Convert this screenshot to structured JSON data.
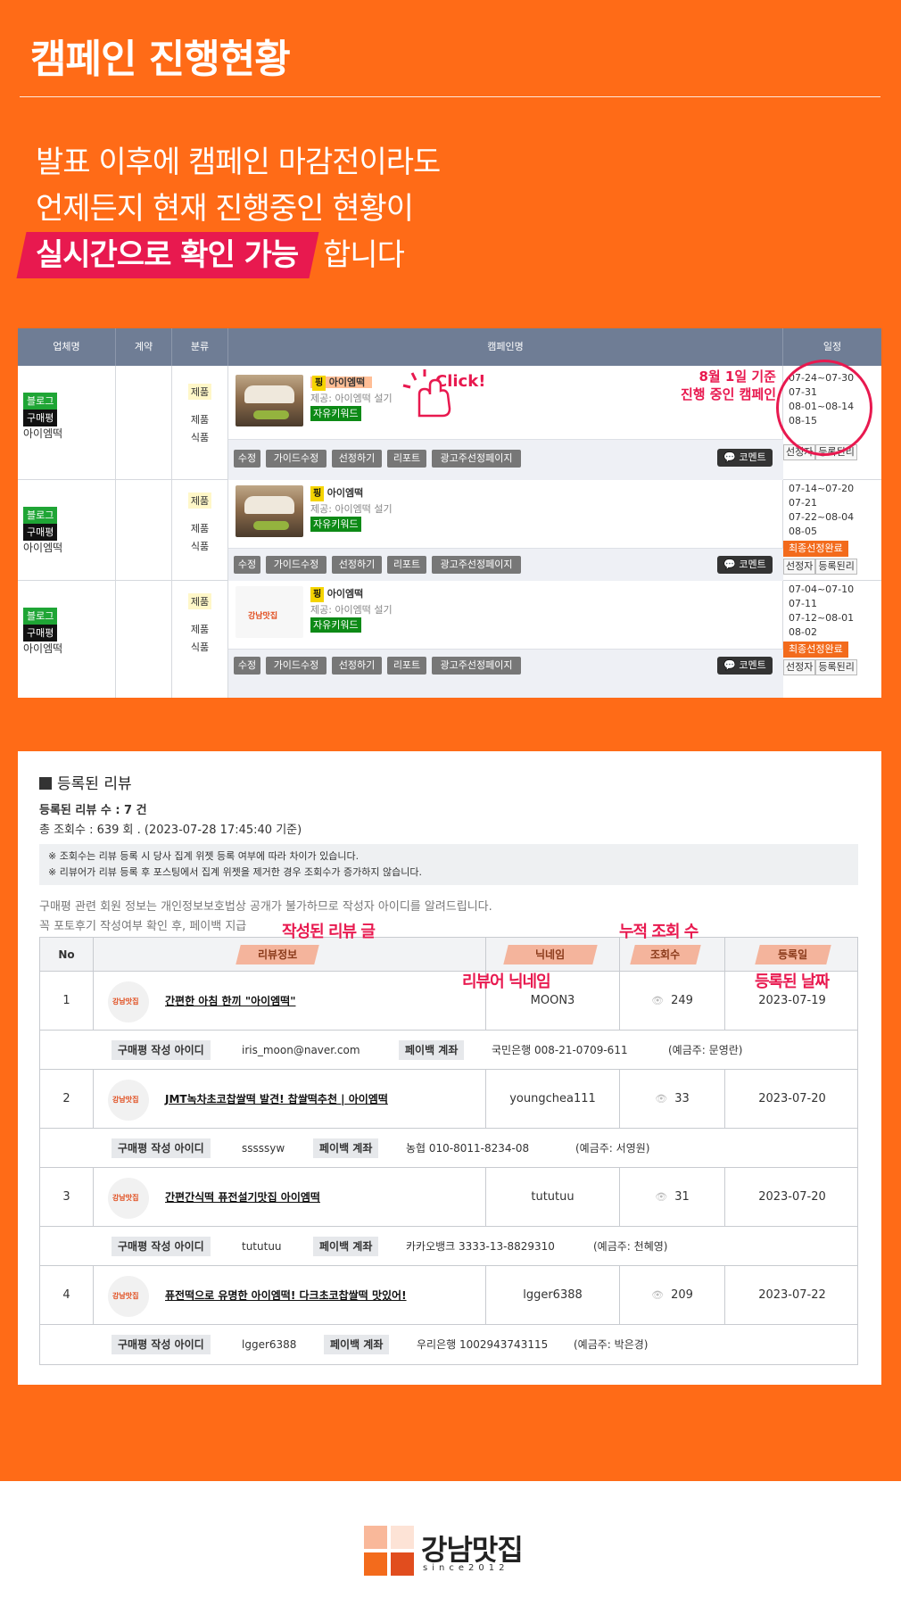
{
  "header": {
    "title": "캠페인 진행현황",
    "intro_line1": "발표 이후에 캠페인 마감전이라도",
    "intro_line2": "언제든지 현재 진행중인 현황이",
    "intro_highlight": "실시간으로 확인 가능",
    "intro_suffix": " 합니다"
  },
  "campaign_table": {
    "columns": [
      "업체명",
      "계약",
      "분류",
      "캠페인명",
      "일정"
    ],
    "rows": [
      {
        "badge_blog": "블로그",
        "badge_buy": "구매평",
        "company": "아이엠떡",
        "class_tag": "제품",
        "class_sub1": "제품",
        "class_sub2": "식품",
        "ping": "핑",
        "name": "아이엠떡",
        "provider": "제공: 아이엠떡 설기",
        "keyword": "자유키워드",
        "buttons": [
          "수정",
          "가이드수정",
          "선정하기",
          "리포트",
          "광고주선정페이지"
        ],
        "comment": "코멘트",
        "dates": [
          "07-24~07-30",
          "07-31",
          "08-01~08-14",
          "08-15"
        ],
        "final": "",
        "date_buttons": [
          "선정자",
          "등록된리"
        ]
      },
      {
        "badge_blog": "블로그",
        "badge_buy": "구매평",
        "company": "아이엠떡",
        "class_tag": "제품",
        "class_sub1": "제품",
        "class_sub2": "식품",
        "ping": "핑",
        "name": "아이엠떡",
        "provider": "제공: 아이엠떡 설기",
        "keyword": "자유키워드",
        "buttons": [
          "수정",
          "가이드수정",
          "선정하기",
          "리포트",
          "광고주선정페이지"
        ],
        "comment": "코멘트",
        "dates": [
          "07-14~07-20",
          "07-21",
          "07-22~08-04",
          "08-05"
        ],
        "final": "최종선정완료",
        "date_buttons": [
          "선정자",
          "등록된리"
        ]
      },
      {
        "badge_blog": "블로그",
        "badge_buy": "구매평",
        "company": "아이엠떡",
        "class_tag": "제품",
        "class_sub1": "제품",
        "class_sub2": "식품",
        "ping": "핑",
        "name": "아이엠떡",
        "provider": "제공: 아이엠떡 설기",
        "keyword": "자유키워드",
        "buttons": [
          "수정",
          "가이드수정",
          "선정하기",
          "리포트",
          "광고주선정페이지"
        ],
        "comment": "코멘트",
        "dates": [
          "07-04~07-10",
          "07-11",
          "07-12~08-01",
          "08-02"
        ],
        "final": "최종선정완료",
        "date_buttons": [
          "선정자",
          "등록된리"
        ]
      }
    ],
    "annotation_click": "Click!",
    "annotation_line1": "8월 1일 기준",
    "annotation_line2": "진행 중인 캠페인",
    "thumb_logo_text": "강남맛집"
  },
  "reviews": {
    "section_title": "등록된 리뷰",
    "count_line": "등록된 리뷰 수 : 7 건",
    "views_line": "총 조회수 : 639 회 . (2023-07-28 17:45:40 기준)",
    "notice1": "※ 조회수는 리뷰 등록 시 당사 집계 위젯 등록 여부에 따라 차이가 있습니다.",
    "notice2": "※ 리뷰어가 리뷰 등록 후 포스팅에서 집계 위젯을 제거한 경우 조회수가 증가하지 않습니다.",
    "info1": "구매평 관련 회원 정보는 개인정보보호법상 공개가 불가하므로 작성자 아이디를 알려드립니다.",
    "info2": "꼭 포토후기 작성여부 확인 후, 페이백 지급",
    "columns": [
      "No",
      "리뷰정보",
      "닉네임",
      "조회수",
      "등록일"
    ],
    "label_buyer_id": "구매평 작성 아이디",
    "label_payback": "페이백 계좌",
    "avatar_text": "강남맛집",
    "rows": [
      {
        "no": "1",
        "title": "간편한 아침 한끼 \"아이엠떡\"",
        "nickname": "MOON3",
        "views": "249",
        "date": "2023-07-19",
        "buyer_id": "iris_moon@naver.com",
        "account": "국민은행   008-21-0709-611",
        "holder": "(예금주: 문영란)"
      },
      {
        "no": "2",
        "title": "JMT녹차초코찹쌀떡 발견! 찹쌀떡추천 | 아이엠떡",
        "nickname": "youngchea111",
        "views": "33",
        "date": "2023-07-20",
        "buyer_id": "sssssyw",
        "account": "농협   010-8011-8234-08",
        "holder": "(예금주: 서영원)"
      },
      {
        "no": "3",
        "title": "간편간식떡 퓨전설기맛집 아이엠떡",
        "nickname": "tututuu",
        "views": "31",
        "date": "2023-07-20",
        "buyer_id": "tututuu",
        "account": "카카오뱅크   3333-13-8829310",
        "holder": "(예금주: 천혜영)"
      },
      {
        "no": "4",
        "title": "퓨전떡으로 유명한 아이엠떡! 다크초코찹쌀떡 맛있어!",
        "nickname": "lgger6388",
        "views": "209",
        "date": "2023-07-22",
        "buyer_id": "lgger6388",
        "account": "우리은행   1002943743115",
        "holder": "(예금주: 박은경)"
      }
    ],
    "annotations": {
      "review_text": "작성된 리뷰 글",
      "cumulative_views": "누적 조회 수",
      "reviewer_nickname": "리뷰어 닉네임",
      "registered_date": "등록된 날짜"
    }
  },
  "footer": {
    "brand": "강남맛집",
    "since": "since2012"
  },
  "colors": {
    "orange": "#ff6b17",
    "highlight": "#e8194f",
    "table_header": "#6f7d95"
  }
}
